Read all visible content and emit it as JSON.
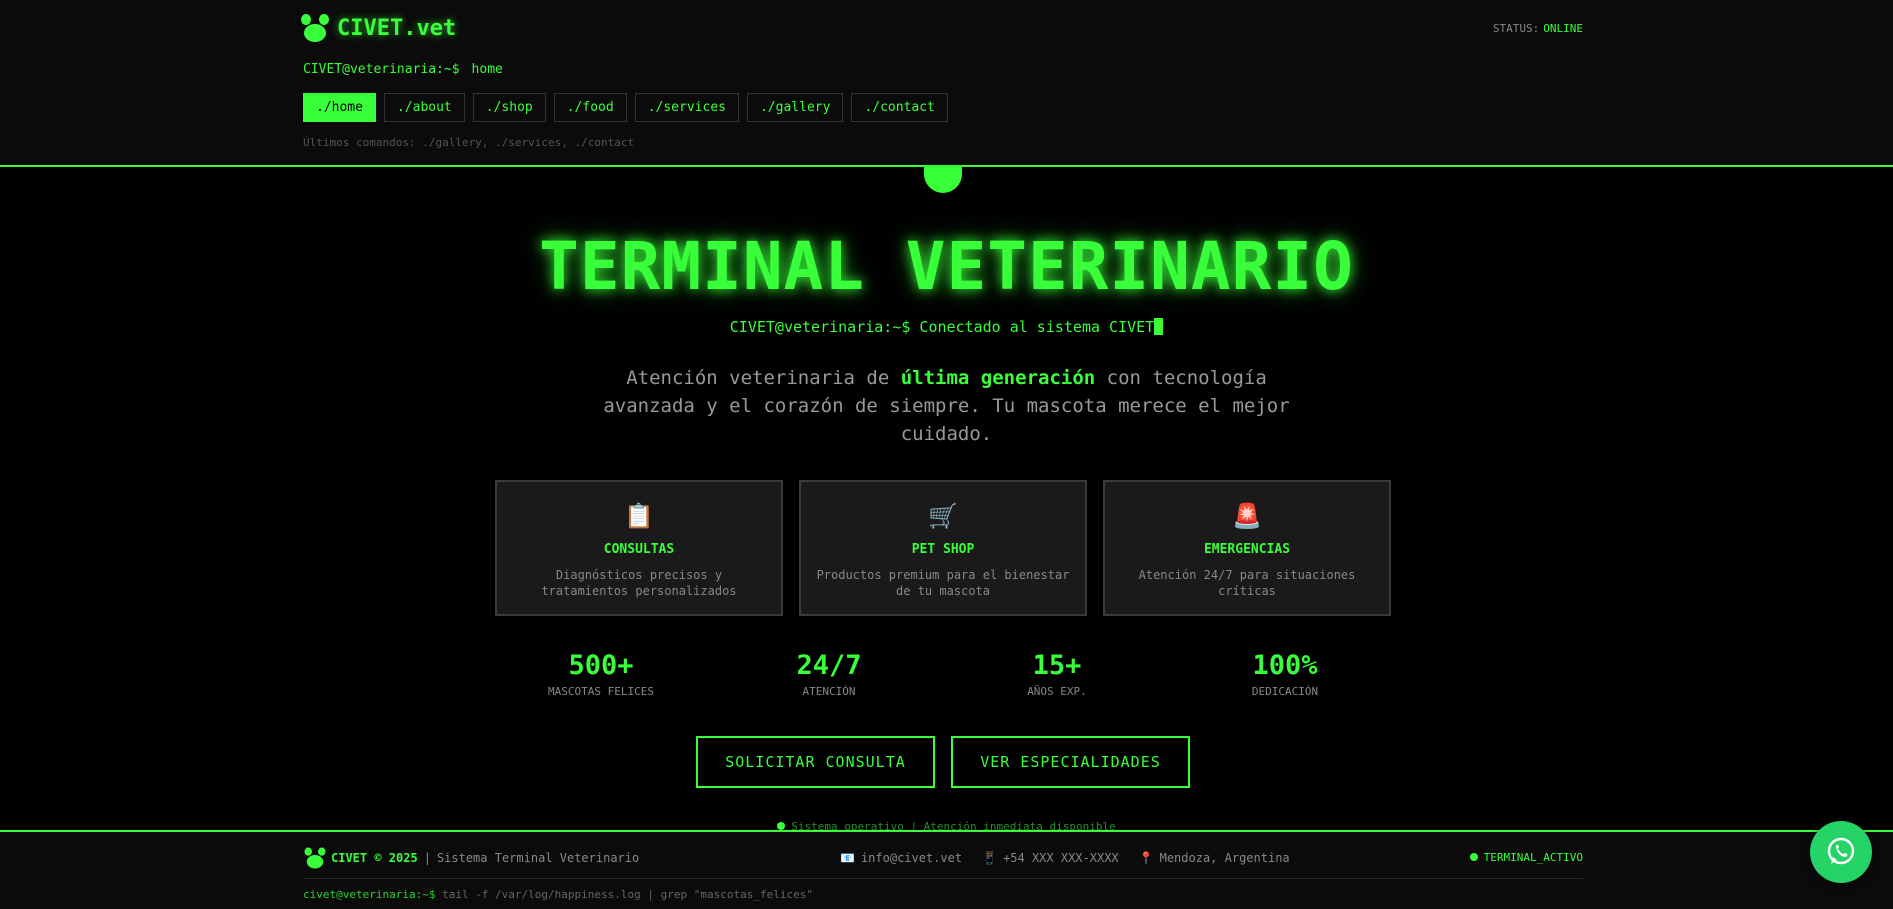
{
  "header": {
    "logo_text": "CIVET.vet",
    "status_label": "STATUS:",
    "status_value": "ONLINE",
    "prompt": "CIVET@veterinaria:~$",
    "prompt_cmd": "home",
    "nav": [
      "./home",
      "./about",
      "./shop",
      "./food",
      "./services",
      "./gallery",
      "./contact"
    ],
    "recent_commands": "Últimos comandos: ./gallery, ./services, ./contact"
  },
  "hero": {
    "title": "TERMINAL VETERINARIO",
    "typed": "CIVET@veterinaria:~$ Conectado al sistema CIVET",
    "desc_pre": "Atención veterinaria de ",
    "desc_strong": "última generación",
    "desc_post": " con tecnología avanzada y el corazón de siempre. Tu mascota merece el mejor cuidado."
  },
  "cards": [
    {
      "icon": "clipboard-icon",
      "glyph": "📋",
      "title": "CONSULTAS",
      "text": "Diagnósticos precisos y tratamientos personalizados"
    },
    {
      "icon": "cart-icon",
      "glyph": "🛒",
      "title": "PET SHOP",
      "text": "Productos premium para el bienestar de tu mascota"
    },
    {
      "icon": "siren-icon",
      "glyph": "🚨",
      "title": "EMERGENCIAS",
      "text": "Atención 24/7 para situaciones críticas"
    }
  ],
  "stats": [
    {
      "num": "500+",
      "label": "MASCOTAS FELICES"
    },
    {
      "num": "24/7",
      "label": "ATENCIÓN"
    },
    {
      "num": "15+",
      "label": "AÑOS EXP."
    },
    {
      "num": "100%",
      "label": "DEDICACIÓN"
    }
  ],
  "buttons": {
    "primary": "SOLICITAR CONSULTA",
    "secondary": "VER ESPECIALIDADES"
  },
  "ticker": "Sistema operativo | Atención inmediata disponible",
  "footer": {
    "brand": "CIVET © 2025",
    "sep": "|",
    "subtitle": "Sistema Terminal Veterinario",
    "email": "info@civet.vet",
    "phone": "+54 XXX XXX-XXXX",
    "location": "Mendoza, Argentina",
    "terminal_status": "TERMINAL_ACTIVO",
    "cmd_user": "civet@veterinaria:~$",
    "cmd": " tail -f /var/log/happiness.log | grep \"mascotas_felices\""
  },
  "colors": {
    "accent": "#39ff3a",
    "background": "#000000",
    "card_bg": "#1a1a1a",
    "whatsapp": "#25d366"
  }
}
